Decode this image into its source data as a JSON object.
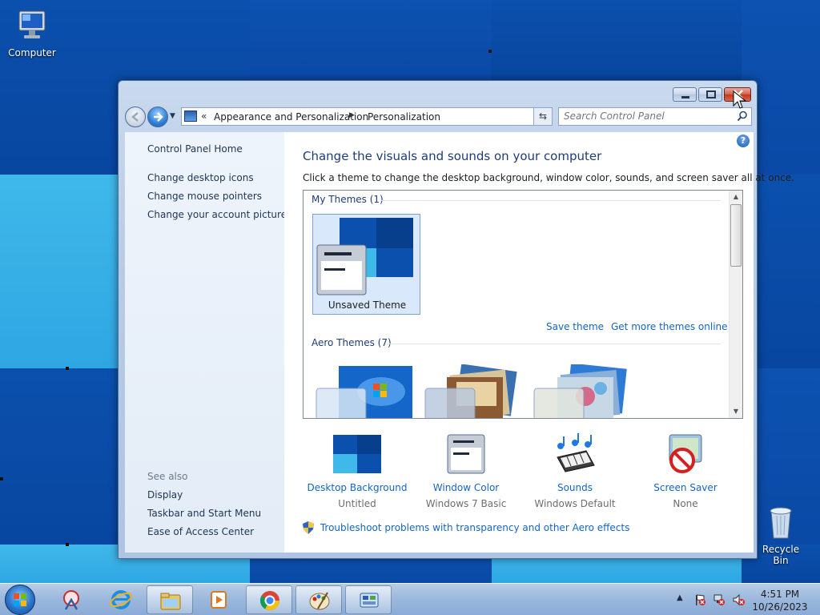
{
  "desktop": {
    "icons": {
      "computer": "Computer",
      "recycle_bin": "Recycle Bin"
    }
  },
  "window": {
    "address": {
      "segment1": "Appearance and Personalization",
      "segment2": "Personalization"
    },
    "search_placeholder": "Search Control Panel"
  },
  "left_pane": {
    "home": "Control Panel Home",
    "links": [
      "Change desktop icons",
      "Change mouse pointers",
      "Change your account picture"
    ],
    "see_also_label": "See also",
    "see_also": [
      "Display",
      "Taskbar and Start Menu",
      "Ease of Access Center"
    ]
  },
  "main": {
    "title": "Change the visuals and sounds on your computer",
    "description": "Click a theme to change the desktop background, window color, sounds, and screen saver all at once.",
    "my_themes_header": "My Themes (1)",
    "unsaved_theme": "Unsaved Theme",
    "save_theme": "Save theme",
    "get_more_themes": "Get more themes online",
    "aero_themes_header": "Aero Themes (7)",
    "settings": [
      {
        "title": "Desktop Background",
        "value": "Untitled"
      },
      {
        "title": "Window Color",
        "value": "Windows 7 Basic"
      },
      {
        "title": "Sounds",
        "value": "Windows Default"
      },
      {
        "title": "Screen Saver",
        "value": "None"
      }
    ],
    "troubleshoot": "Troubleshoot problems with transparency and other Aero effects"
  },
  "taskbar": {
    "time": "4:51 PM",
    "date": "10/26/2023"
  },
  "colors": {
    "link": "#1565c0",
    "title": "#1e3c78",
    "desktop_dark": "#0a4ba0",
    "desktop_light": "#3fb8ea"
  }
}
